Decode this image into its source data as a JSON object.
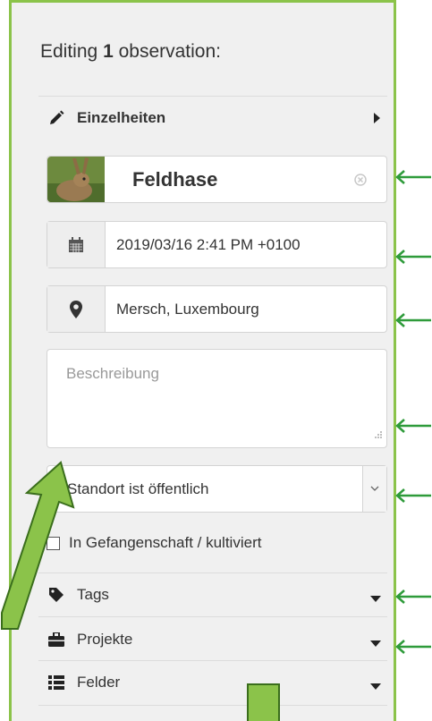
{
  "header": {
    "title_prefix": "Editing",
    "title_count": "1",
    "title_suffix": "observation:"
  },
  "details": {
    "label": "Einzelheiten"
  },
  "species": {
    "value": "Feldhase"
  },
  "date": {
    "value": "2019/03/16 2:41 PM +0100"
  },
  "location": {
    "value": "Mersch, Luxembourg"
  },
  "description": {
    "placeholder": "Beschreibung"
  },
  "geoprivacy": {
    "selected": "Standort ist öffentlich"
  },
  "captive": {
    "label": "In Gefangenschaft / kultiviert"
  },
  "sections": {
    "tags": "Tags",
    "projects": "Projekte",
    "fields": "Felder"
  },
  "colors": {
    "accent_green": "#8bc34a",
    "arrow_green": "#2e9b3a"
  }
}
